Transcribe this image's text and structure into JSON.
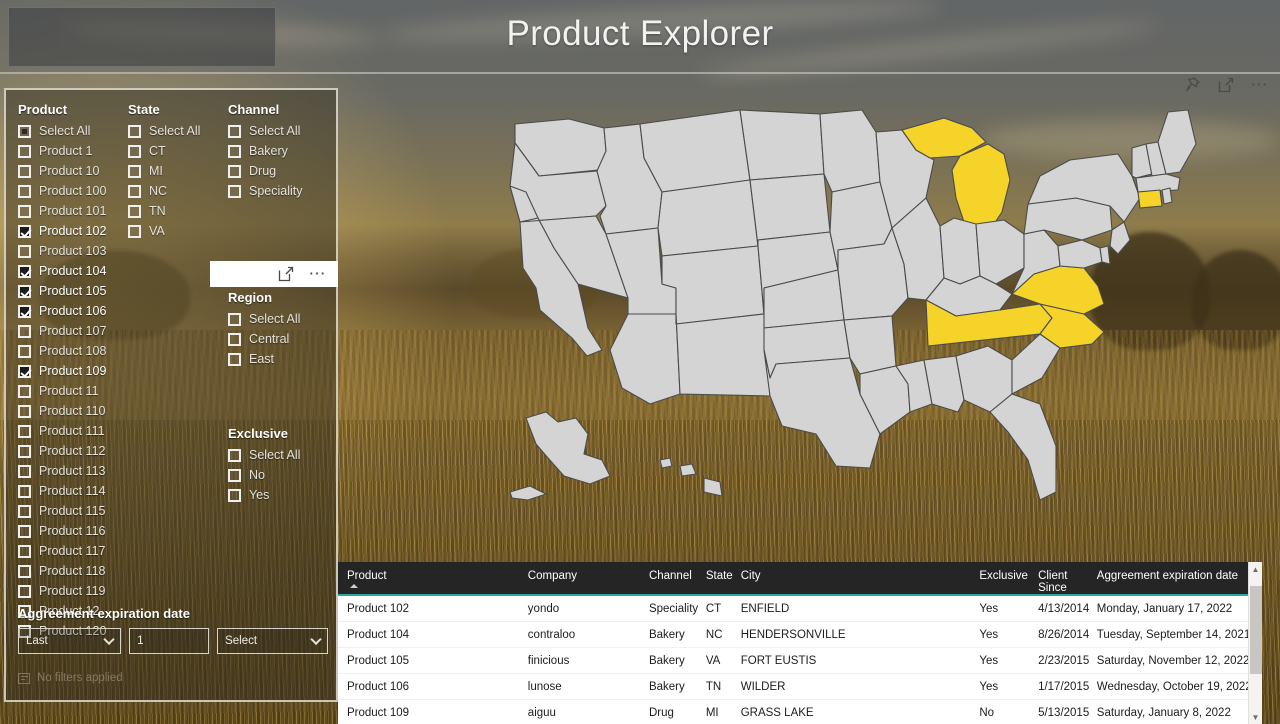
{
  "header": {
    "title": "Product Explorer"
  },
  "visual_header_icons": [
    {
      "name": "pin-icon",
      "label": "Pin to dashboard"
    },
    {
      "name": "focus-mode-icon",
      "label": "Focus mode"
    },
    {
      "name": "more-options-icon",
      "label": "More options"
    }
  ],
  "slicers": {
    "product": {
      "title": "Product",
      "items": [
        {
          "label": "Select All",
          "state": "partial"
        },
        {
          "label": "Product 1",
          "state": "unchecked"
        },
        {
          "label": "Product 10",
          "state": "unchecked"
        },
        {
          "label": "Product 100",
          "state": "unchecked"
        },
        {
          "label": "Product 101",
          "state": "unchecked"
        },
        {
          "label": "Product 102",
          "state": "checked"
        },
        {
          "label": "Product 103",
          "state": "unchecked"
        },
        {
          "label": "Product 104",
          "state": "checked"
        },
        {
          "label": "Product 105",
          "state": "checked"
        },
        {
          "label": "Product 106",
          "state": "checked"
        },
        {
          "label": "Product 107",
          "state": "unchecked"
        },
        {
          "label": "Product 108",
          "state": "unchecked"
        },
        {
          "label": "Product 109",
          "state": "checked"
        },
        {
          "label": "Product 11",
          "state": "unchecked"
        },
        {
          "label": "Product 110",
          "state": "unchecked"
        },
        {
          "label": "Product 111",
          "state": "unchecked"
        },
        {
          "label": "Product 112",
          "state": "unchecked"
        },
        {
          "label": "Product 113",
          "state": "unchecked"
        },
        {
          "label": "Product 114",
          "state": "unchecked"
        },
        {
          "label": "Product 115",
          "state": "unchecked"
        },
        {
          "label": "Product 116",
          "state": "unchecked"
        },
        {
          "label": "Product 117",
          "state": "unchecked"
        },
        {
          "label": "Product 118",
          "state": "unchecked"
        },
        {
          "label": "Product 119",
          "state": "unchecked"
        },
        {
          "label": "Product 12",
          "state": "unchecked"
        },
        {
          "label": "Product 120",
          "state": "unchecked"
        }
      ]
    },
    "state": {
      "title": "State",
      "items": [
        {
          "label": "Select All",
          "state": "unchecked"
        },
        {
          "label": "CT",
          "state": "unchecked"
        },
        {
          "label": "MI",
          "state": "unchecked"
        },
        {
          "label": "NC",
          "state": "unchecked"
        },
        {
          "label": "TN",
          "state": "unchecked"
        },
        {
          "label": "VA",
          "state": "unchecked"
        }
      ]
    },
    "channel": {
      "title": "Channel",
      "items": [
        {
          "label": "Select All",
          "state": "unchecked"
        },
        {
          "label": "Bakery",
          "state": "unchecked"
        },
        {
          "label": "Drug",
          "state": "unchecked"
        },
        {
          "label": "Speciality",
          "state": "unchecked"
        }
      ]
    },
    "region": {
      "title": "Region",
      "items": [
        {
          "label": "Select All",
          "state": "unchecked"
        },
        {
          "label": "Central",
          "state": "unchecked"
        },
        {
          "label": "East",
          "state": "unchecked"
        }
      ]
    },
    "exclusive": {
      "title": "Exclusive",
      "items": [
        {
          "label": "Select All",
          "state": "unchecked"
        },
        {
          "label": "No",
          "state": "unchecked"
        },
        {
          "label": "Yes",
          "state": "unchecked"
        }
      ]
    },
    "date_filter": {
      "title": "Aggreement expiration date",
      "range_value": "Last",
      "number_value": "1",
      "unit_value": "Select"
    },
    "footer_status": "No filters applied"
  },
  "map": {
    "highlight_color": "#f5d328",
    "base_color": "#d4d4d4",
    "border_color": "#4a4a4a",
    "highlighted_states": [
      "MI",
      "CT",
      "VA",
      "TN",
      "NC"
    ]
  },
  "table": {
    "columns": [
      "Product",
      "Company",
      "Channel",
      "State",
      "City",
      "Exclusive",
      "Client Since",
      "Aggreement expiration date"
    ],
    "sorted_by": "Product",
    "sort_direction": "ascending",
    "rows": [
      {
        "product": "Product 102",
        "company": "yondo",
        "channel": "Speciality",
        "state": "CT",
        "city": "ENFIELD",
        "exclusive": "Yes",
        "client_since": "4/13/2014",
        "expiration": "Monday, January 17, 2022"
      },
      {
        "product": "Product 104",
        "company": "contraloo",
        "channel": "Bakery",
        "state": "NC",
        "city": "HENDERSONVILLE",
        "exclusive": "Yes",
        "client_since": "8/26/2014",
        "expiration": "Tuesday, September 14, 2021"
      },
      {
        "product": "Product 105",
        "company": "finicious",
        "channel": "Bakery",
        "state": "VA",
        "city": "FORT EUSTIS",
        "exclusive": "Yes",
        "client_since": "2/23/2015",
        "expiration": "Saturday, November 12, 2022"
      },
      {
        "product": "Product 106",
        "company": "lunose",
        "channel": "Bakery",
        "state": "TN",
        "city": "WILDER",
        "exclusive": "Yes",
        "client_since": "1/17/2015",
        "expiration": "Wednesday, October 19, 2022"
      },
      {
        "product": "Product 109",
        "company": "aiguu",
        "channel": "Drug",
        "state": "MI",
        "city": "GRASS LAKE",
        "exclusive": "No",
        "client_since": "5/13/2015",
        "expiration": "Saturday, January 8, 2022"
      }
    ]
  }
}
